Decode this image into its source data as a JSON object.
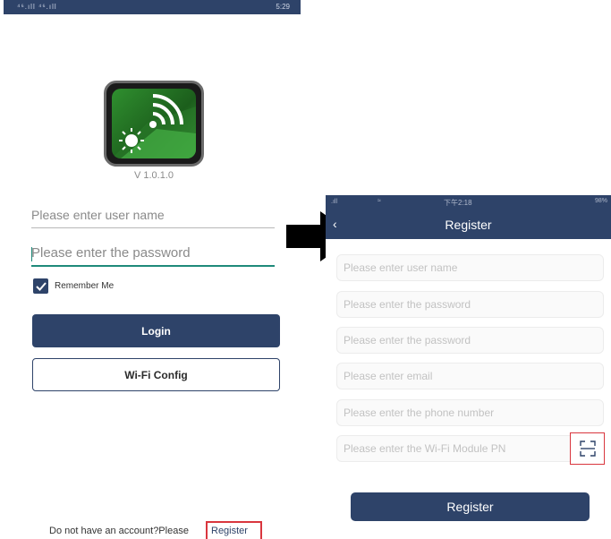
{
  "colors": {
    "brand": "#2e4369",
    "accent": "#1f8a7a",
    "highlight": "#d9363e"
  },
  "login_screen": {
    "status_bar": {
      "signal": "⁴⁶.ıll ⁴⁶.ıll",
      "time": "5:29"
    },
    "app_icon": "solar-wifi-app-icon",
    "version": "V 1.0.1.0",
    "username_placeholder": "Please enter user name",
    "password_placeholder": "Please enter the password",
    "remember_me": {
      "label": "Remember Me",
      "checked": true
    },
    "login_label": "Login",
    "wifi_config_label": "Wi-Fi Config",
    "register_prompt": "Do not have an account?Please",
    "register_link": "Register"
  },
  "arrow_icon": "right-arrow-icon",
  "register_screen": {
    "status_bar": {
      "signal": ".ıll",
      "wifi": "≈",
      "time": "下午2:18",
      "battery": "98%"
    },
    "back_icon": "back-arrow-icon",
    "title": "Register",
    "fields": {
      "username": "Please enter user name",
      "password": "Please enter the password",
      "confirm_password": "Please enter the password",
      "email": "Please enter email",
      "phone": "Please enter the phone number",
      "wifi_module_pn": "Please enter the Wi-Fi Module PN"
    },
    "scan_icon": "scan-icon",
    "register_button": "Register"
  }
}
